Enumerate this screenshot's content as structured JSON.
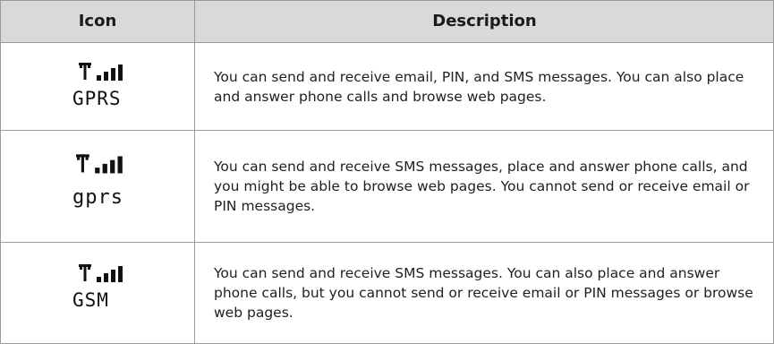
{
  "table": {
    "headers": {
      "icon": "Icon",
      "description": "Description"
    },
    "rows": [
      {
        "icon_name": "signal-bars-icon",
        "network_label": "GPRS",
        "description": "You can send and receive email, PIN, and SMS messages. You can also place and answer phone calls and browse web pages."
      },
      {
        "icon_name": "signal-bars-icon",
        "network_label": "gprs",
        "description": "You can send and receive SMS messages, place and answer phone calls, and you might be able to browse web pages. You cannot send or receive email or PIN messages."
      },
      {
        "icon_name": "signal-bars-icon",
        "network_label": "GSM",
        "description": "You can send and receive SMS messages. You can also place and answer phone calls, but you cannot send or receive email or PIN messages or browse web pages."
      }
    ]
  },
  "colors": {
    "header_bg": "#d9d9d9",
    "border": "#9a9a9a",
    "text": "#1a1a1a"
  }
}
